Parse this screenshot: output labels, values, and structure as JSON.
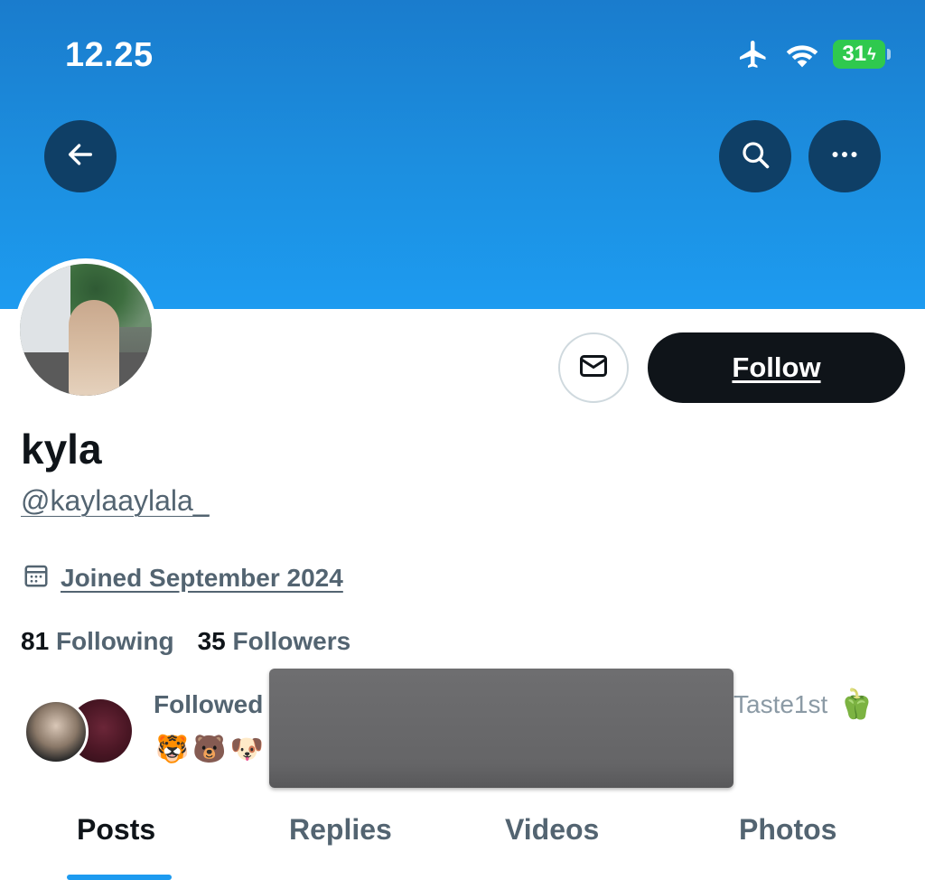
{
  "status_bar": {
    "time": "12.25",
    "battery": "31",
    "icons": [
      "airplane-icon",
      "wifi-icon",
      "battery-charging-icon"
    ]
  },
  "header": {
    "back_icon": "arrow-left-icon",
    "search_icon": "search-icon",
    "more_icon": "more-icon"
  },
  "profile": {
    "display_name": "kyla",
    "handle": "@kaylaaylala_",
    "joined": "Joined September 2024",
    "following_count": "81",
    "following_label": "Following",
    "followers_count": "35",
    "followers_label": "Followers",
    "follow_label": "Follow",
    "message_icon": "mail-icon"
  },
  "followed_by": {
    "prefix": "Followed",
    "visible_name": "Taste1st",
    "name_emoji": "🫑",
    "emojis": "🐯🐻🐶"
  },
  "tabs": [
    {
      "label": "Posts",
      "active": true
    },
    {
      "label": "Replies",
      "active": false
    },
    {
      "label": "Videos",
      "active": false
    },
    {
      "label": "Photos",
      "active": false
    }
  ],
  "colors": {
    "accent": "#1d9bf0",
    "banner": "#1c8fe0",
    "text_primary": "#0f1419",
    "text_secondary": "#536471"
  }
}
